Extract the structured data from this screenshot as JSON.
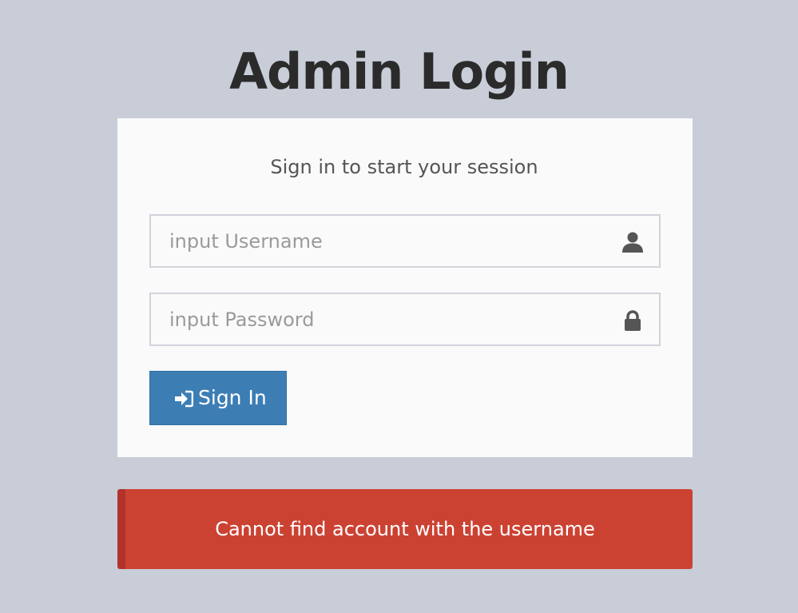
{
  "page": {
    "title": "Admin Login"
  },
  "login_box": {
    "message": "Sign in to start your session",
    "username": {
      "placeholder": "input Username",
      "value": "",
      "icon": "user-icon"
    },
    "password": {
      "placeholder": "input Password",
      "value": "",
      "icon": "lock-icon"
    },
    "signin_button": {
      "label": "Sign In",
      "icon": "sign-in-icon"
    }
  },
  "alert": {
    "message": "Cannot find account with the username",
    "color": "#cc4232"
  },
  "colors": {
    "background": "#c8cdd8",
    "box": "#fafafa",
    "button": "#3c7eb4",
    "title": "#2b2b2b"
  }
}
